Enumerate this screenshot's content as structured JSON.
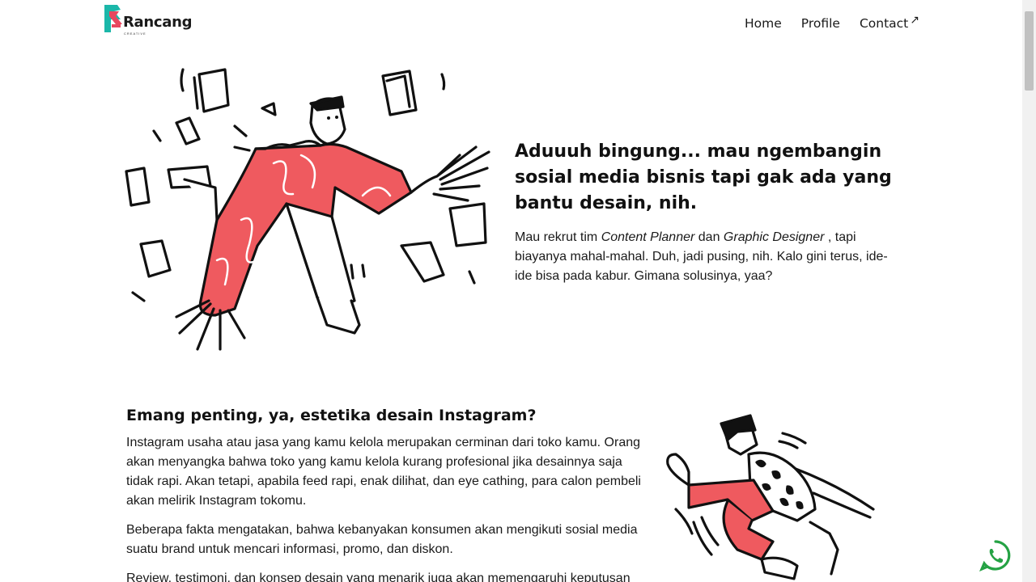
{
  "brand": {
    "name": "Rancang",
    "tagline": "CREATIVE"
  },
  "nav": {
    "home": "Home",
    "profile": "Profile",
    "contact": "Contact",
    "contact_icon": "↗"
  },
  "hero": {
    "title": "Aduuuh bingung... mau ngembangin sosial media bisnis tapi gak ada yang bantu desain, nih.",
    "desc_part1": "Mau rekrut tim ",
    "desc_em1": "Content Planner",
    "desc_part2": " dan ",
    "desc_em2": "Graphic Designer",
    "desc_part3": " , tapi biayanya mahal-mahal. Duh, jadi pusing, nih. Kalo gini terus, ide-ide bisa pada kabur. Gimana solusinya, yaa?"
  },
  "section2": {
    "title": "Emang penting, ya, estetika desain Instagram?",
    "p1": "Instagram usaha atau jasa yang kamu kelola merupakan cerminan dari toko kamu. Orang akan menyangka bahwa toko yang kamu kelola kurang profesional jika desainnya saja tidak rapi. Akan tetapi, apabila feed rapi, enak dilihat, dan eye cathing, para calon pembeli akan melirik Instagram tokomu.",
    "p2": "Beberapa fakta mengatakan, bahwa kebanyakan konsumen akan mengikuti sosial media suatu brand untuk mencari informasi, promo, dan diskon.",
    "p3": "Review, testimoni, dan konsep desain yang menarik juga akan memengaruhi keputusan"
  },
  "icons": {
    "logo": "rancang-logo-icon",
    "whatsapp": "whatsapp-icon",
    "external": "external-link-icon"
  },
  "colors": {
    "accent_red": "#ef5a5f",
    "logo_teal": "#1bb7a9",
    "logo_pink": "#e8475e",
    "whatsapp_green": "#25a244"
  }
}
